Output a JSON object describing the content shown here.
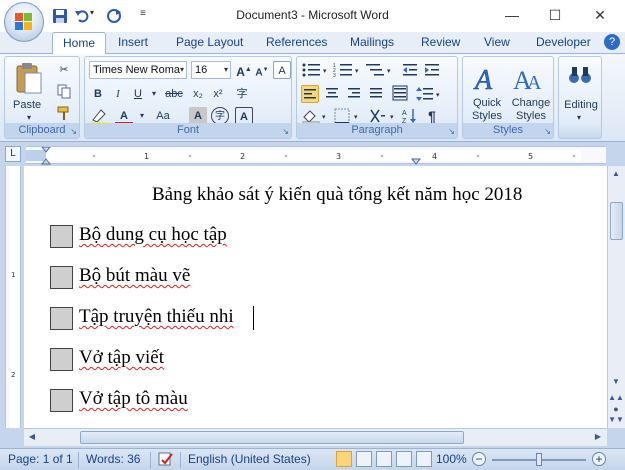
{
  "window": {
    "title": "Document3 - Microsoft Word",
    "min_glyph": "—",
    "max_glyph": "☐",
    "close_glyph": "✕"
  },
  "tabs": [
    "Home",
    "Insert",
    "Page Layout",
    "References",
    "Mailings",
    "Review",
    "View",
    "Developer"
  ],
  "ribbon": {
    "clipboard": {
      "label": "Clipboard",
      "paste_label": "Paste"
    },
    "font": {
      "label": "Font",
      "font_name": "Times New Roma",
      "font_size": "16",
      "bold": "B",
      "italic": "I",
      "underline": "U",
      "strike": "abc",
      "subscript": "x₂",
      "superscript": "x²",
      "font_color": "A",
      "change_case": "Aa",
      "char_shading": "A",
      "enclose": "字"
    },
    "paragraph": {
      "label": "Paragraph",
      "pilcrow": "¶"
    },
    "styles": {
      "label": "Styles",
      "quick_styles": "Quick Styles",
      "change_styles": "Change Styles"
    },
    "editing": {
      "label": "Editing"
    }
  },
  "document": {
    "heading": "Bảng khảo sát ý kiến quà tổng kết năm học 2018",
    "items": [
      "Bộ dung cụ học tập",
      "Bộ bút màu vẽ",
      "Tập truyện thiếu nhi",
      "Vở tập viết",
      "Vở tập tô màu"
    ],
    "checkbox_color": "#cfcfcf"
  },
  "statusbar": {
    "page": "Page: 1 of 1",
    "words": "Words: 36",
    "language": "English (United States)",
    "zoom": "100%"
  },
  "icons": {
    "save": "save-icon",
    "undo": "undo-icon",
    "redo": "redo-icon",
    "paste": "paste-icon",
    "cut": "cut-icon",
    "copy": "copy-icon",
    "format_painter": "format-painter-icon"
  },
  "colors": {
    "accent": "#15428b",
    "ribbon_bg": "#dce7f5",
    "spell_underline": "#e02020"
  }
}
